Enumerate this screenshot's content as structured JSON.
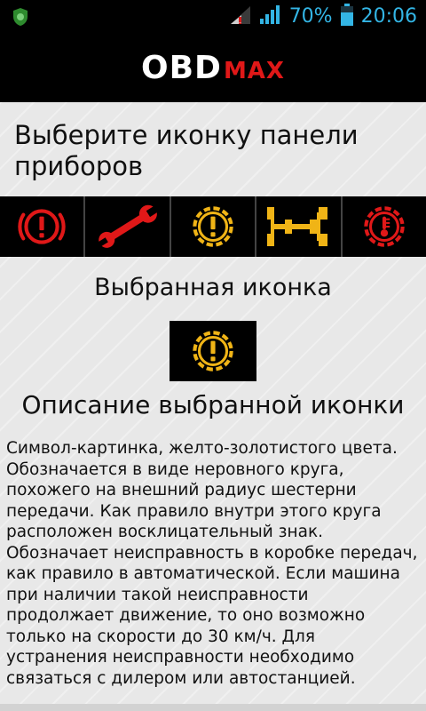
{
  "status_bar": {
    "battery_percent": "70%",
    "time": "20:06",
    "accent_color": "#33b5e5",
    "icons": [
      "notification-app-icon",
      "signal-icon",
      "wifi-signal-icon",
      "battery-icon"
    ]
  },
  "header": {
    "logo_part1": "OBD",
    "logo_part2": "MAX",
    "logo_colors": {
      "obd": "#ffffff",
      "max": "#e01818"
    }
  },
  "main": {
    "choose_title": "Выберите иконку панели приборов",
    "icons": [
      {
        "name": "brake-warning-icon",
        "color": "#e01818",
        "selected": false
      },
      {
        "name": "wrench-icon",
        "color": "#e01818",
        "selected": false
      },
      {
        "name": "transmission-warning-icon",
        "color": "#f0b416",
        "selected": true
      },
      {
        "name": "drivetrain-icon",
        "color": "#f0b416",
        "selected": false
      },
      {
        "name": "temperature-warning-icon",
        "color": "#e01818",
        "selected": false
      }
    ],
    "selected_title": "Выбранная иконка",
    "selected_icon": {
      "name": "transmission-warning-icon",
      "color": "#f0b416"
    },
    "description_title": "Описание выбранной иконки",
    "description_text": "Символ-картинка, желто-золотистого цвета. Обозначается в виде неровного круга, похожего на внешний радиус шестерни передачи. Как правило внутри этого круга расположен восклицательный знак. Обозначает неисправность в коробке передач, как правило в автоматической. Если машина при наличии такой неисправности продолжает движение, то оно возможно только на скорости до 30 км/ч. Для устранения неисправности необходимо связаться с дилером или автостанцией."
  }
}
